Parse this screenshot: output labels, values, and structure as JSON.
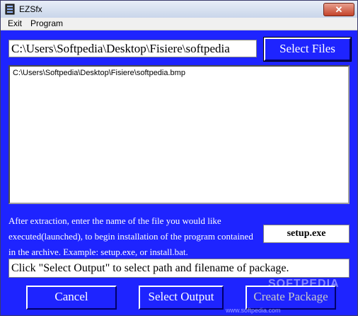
{
  "window": {
    "title": "EZSfx",
    "close_icon": "close-icon",
    "app_icon": "app-icon"
  },
  "menu": {
    "items": [
      "Exit",
      "Program"
    ]
  },
  "files": {
    "path_value": "C:\\Users\\Softpedia\\Desktop\\Fisiere\\softpedia",
    "select_files_label": "Select Files",
    "list": [
      "C:\\Users\\Softpedia\\Desktop\\Fisiere\\softpedia.bmp"
    ]
  },
  "execute": {
    "instructions": "After extraction, enter the name of the file you would like executed(launched), to begin installation of the program contained in the archive. Example: setup.exe, or install.bat.",
    "value": "setup.exe"
  },
  "status": {
    "text": "Click \"Select Output\" to select path and filename of package."
  },
  "buttons": {
    "cancel": "Cancel",
    "select_output": "Select Output",
    "create_package": "Create Package"
  },
  "watermark": {
    "text": "SOFTPEDIA",
    "url": "www.softpedia.com"
  },
  "colors": {
    "background": "#1e24ff",
    "disabled_text": "#c8c8c8"
  }
}
